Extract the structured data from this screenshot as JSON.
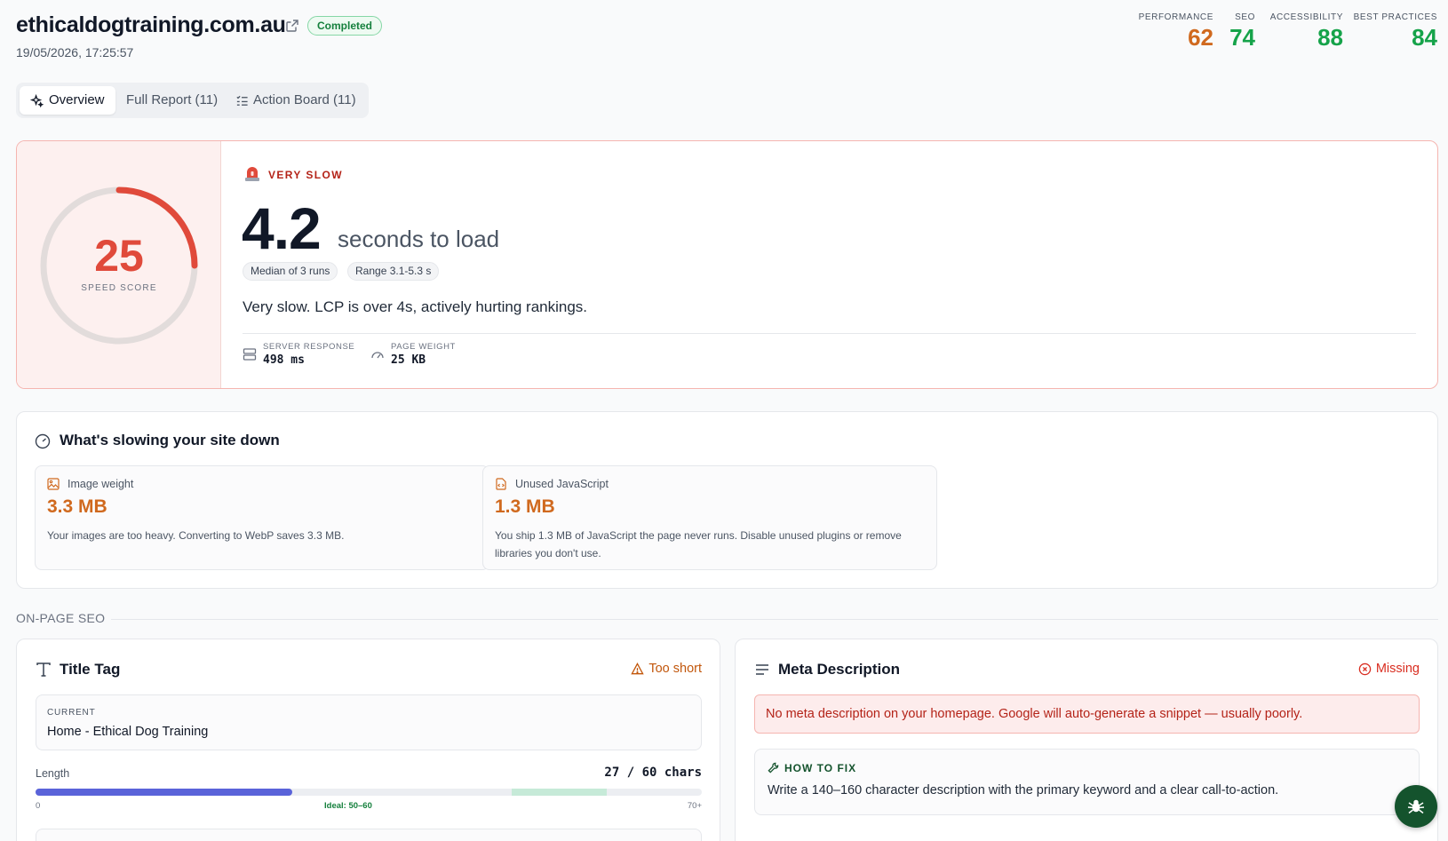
{
  "header": {
    "site": "ethicaldogtraining.com.au",
    "status": "Completed",
    "timestamp": "19/05/2026, 17:25:57"
  },
  "scores": [
    {
      "label": "PERFORMANCE",
      "value": "62",
      "color": "#d0691e"
    },
    {
      "label": "SEO",
      "value": "74",
      "color": "#16a34a"
    },
    {
      "label": "ACCESSIBILITY",
      "value": "88",
      "color": "#16a34a"
    },
    {
      "label": "BEST PRACTICES",
      "value": "84",
      "color": "#16a34a"
    }
  ],
  "tabs": {
    "overview": "Overview",
    "full_report": "Full Report (11)",
    "action_board": "Action Board (11)"
  },
  "speed": {
    "score": "25",
    "score_fraction": 0.25,
    "score_label": "SPEED SCORE",
    "severity": "VERY SLOW",
    "seconds": "4.2",
    "unit": "seconds to load",
    "chip_median": "Median of 3 runs",
    "chip_range": "Range 3.1-5.3 s",
    "description": "Very slow. LCP is over 4s, actively hurting rankings.",
    "server_label": "SERVER RESPONSE",
    "server_value": "498 ms",
    "weight_label": "PAGE WEIGHT",
    "weight_value": "25 KB"
  },
  "slowing": {
    "title": "What's slowing your site down",
    "items": [
      {
        "name": "Image weight",
        "amount": "3.3 MB",
        "desc": "Your images are too heavy. Converting to WebP saves 3.3 MB."
      },
      {
        "name": "Unused JavaScript",
        "amount": "1.3 MB",
        "desc": "You ship 1.3 MB of JavaScript the page never runs. Disable unused plugins or remove libraries you don't use."
      }
    ]
  },
  "onpage": {
    "section_label": "ON-PAGE SEO",
    "title_tag": {
      "title": "Title Tag",
      "status": "Too short",
      "current_label": "CURRENT",
      "current_value": "Home - Ethical Dog Training",
      "length_label": "Length",
      "length_value": "27 / 60 chars",
      "length_fraction": 0.385,
      "tick_min": "0",
      "tick_ideal": "Ideal: 50–60",
      "tick_max": "70+"
    },
    "meta": {
      "title": "Meta Description",
      "status": "Missing",
      "alert": "No meta description on your homepage. Google will auto-generate a snippet — usually poorly.",
      "fix_label": "HOW TO FIX",
      "fix_text": "Write a 140–160 character description with the primary keyword and a clear call-to-action."
    }
  }
}
